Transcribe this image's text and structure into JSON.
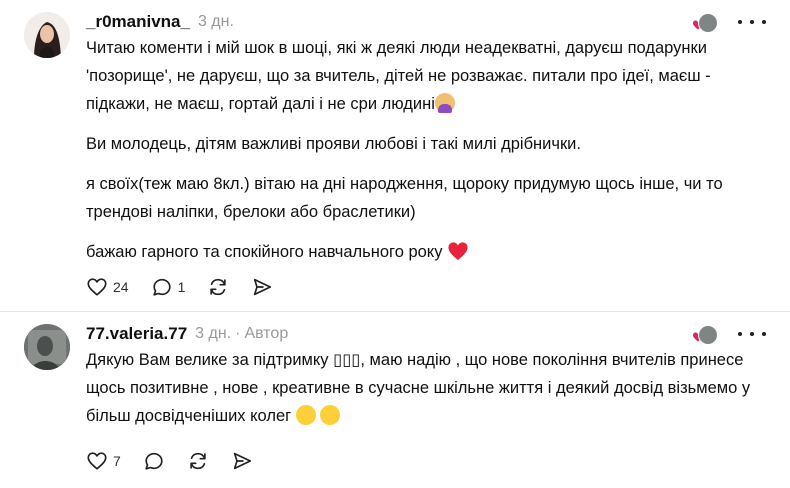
{
  "comments": [
    {
      "username": "_r0manivna_",
      "time": "3 дн.",
      "author_label": "",
      "paragraphs": [
        "Читаю коменти і мій шок в шоці, які ж деякі люди неадекватні, даруєш подарунки 'позорище', не даруєш, що за вчитель, дітей не розважає. питали про ідеї, маєш - підкажи, не маєш, гортай далі і не сри людині",
        "Ви молодець, дітям важливі прояви любові і такі милі дрібнички.",
        "я своїх(теж маю 8кл.) вітаю на дні народження, щороку придумую щось інше, чи то трендові наліпки, брелоки або браслетики)",
        "бажаю гарного та спокійного навчального року"
      ],
      "like_count": "24",
      "reply_count": "1",
      "repost_count": "",
      "share_count": ""
    },
    {
      "username": "77.valeria.77",
      "time": "3 дн.",
      "author_label": "Автор",
      "paragraphs": [
        "Дякую Вам велике за підтримку ▯▯▯, маю надію , що нове покоління вчителів принесе щось позитивне , нове , креативне в сучасне шкільне життя і деякий досвід візьмемо у більш досвідченіших колег"
      ],
      "like_count": "7",
      "reply_count": "",
      "repost_count": "",
      "share_count": ""
    }
  ],
  "icons": {
    "like": "heart-outline-icon",
    "reply": "speech-bubble-icon",
    "repost": "repost-arrows-icon",
    "share": "send-paper-plane-icon",
    "more": "more-dots-icon",
    "liked_by_author": "red-heart-icon"
  },
  "colors": {
    "text": "#101010",
    "meta": "#999999",
    "heart": "#e0245e",
    "divider": "#e6e6e6"
  }
}
